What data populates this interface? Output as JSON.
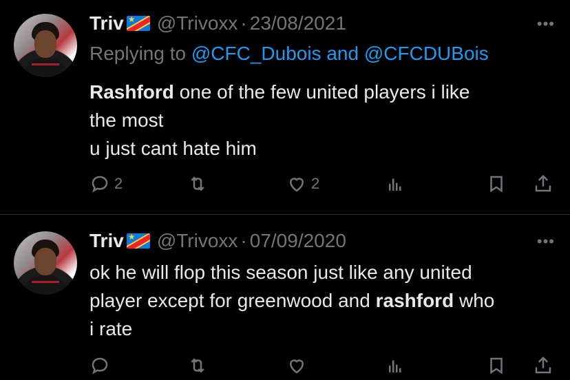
{
  "tweets": [
    {
      "name": "Triv",
      "handle": "@Trivoxx",
      "dot": "·",
      "date": "23/08/2021",
      "more": "•••",
      "replying_prefix": "Replying to ",
      "mention1": "@CFC_Dubois",
      "replying_and": " and ",
      "mention2": "@CFCDUBois",
      "body": {
        "line1_bold": "Rashford",
        "line1_rest": " one of the few united players i like",
        "line2": "the most",
        "line3": "u just cant hate him"
      },
      "actions": {
        "replies": "2",
        "retweets": "",
        "likes": "2"
      }
    },
    {
      "name": "Triv",
      "handle": "@Trivoxx",
      "dot": "·",
      "date": "07/09/2020",
      "more": "•••",
      "body": {
        "line1": "ok he will flop this season just like any united",
        "line2_pre": "player except for greenwood and ",
        "line2_bold": "rashford",
        "line2_post": " who",
        "line3": "i rate"
      },
      "actions": {
        "replies": "",
        "retweets": "",
        "likes": ""
      }
    }
  ],
  "icons": [
    "reply-icon",
    "retweet-icon",
    "like-icon",
    "views-icon",
    "bookmark-icon",
    "share-icon",
    "more-icon",
    "flag-icon"
  ]
}
